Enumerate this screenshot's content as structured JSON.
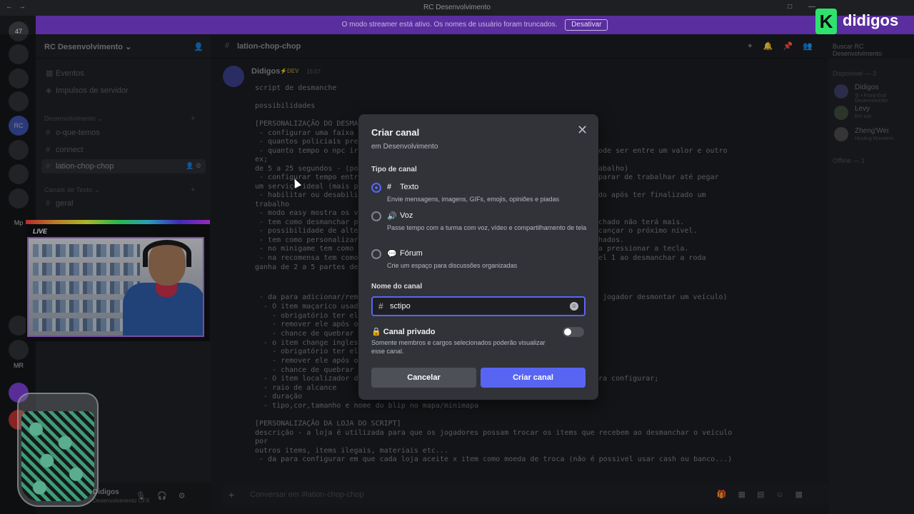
{
  "window": {
    "title": "RC Desenvolvimento"
  },
  "banner": {
    "text": "O modo streamer está ativo. Os nomes de usuário foram truncados.",
    "dismiss_label": "Desativar"
  },
  "servers": [
    {
      "label": "47"
    },
    {
      "label": ""
    },
    {
      "label": ""
    },
    {
      "label": ""
    },
    {
      "label": "RC"
    },
    {
      "label": ""
    },
    {
      "label": ""
    },
    {
      "label": ""
    },
    {
      "label": "Mp"
    },
    {
      "label": ""
    },
    {
      "label": ""
    },
    {
      "label": "MR"
    },
    {
      "label": ""
    },
    {
      "label": ""
    }
  ],
  "sidebar": {
    "guild_name": "RC Desenvolvimento",
    "top_items": [
      {
        "label": "Eventos"
      },
      {
        "label": "Impulsos de servidor"
      }
    ],
    "categories": [
      {
        "label": "Desenvolvimento"
      },
      {
        "label": "Canais de Texto"
      }
    ],
    "channels": [
      {
        "label": "o-que-temos"
      },
      {
        "label": "connect"
      },
      {
        "label": "lation-chop-chop"
      },
      {
        "label": "geral"
      }
    ],
    "user": {
      "name": "Didigos",
      "status": "Desenvolvimento CFX"
    }
  },
  "webcam": {
    "live_label": "LIVE"
  },
  "chat": {
    "channel_name": "lation-chop-chop",
    "search_placeholder": "Buscar RC Desenvolvimento",
    "composer_placeholder": "Conversar em #lation-chop-chop",
    "message": {
      "author": "Didigos",
      "badge": "⚡DEV",
      "time": "15:07",
      "lines": [
        "script de desmanche",
        "possibilidades",
        "[PERSONALIZAÇÃO DO DESMANCHE]",
        " - configurar uma faixa de",
        " - quantos policiais preci",
        " - quanto tempo o npc irá",
        "ex;",
        "de 5 a 25 segundos - (pod",
        " - configurar tempo entre",
        "um serviço ideal (mais pe",
        " - habilitar ou desabilita",
        "trabalho",
        " - modo easy mostra os ve",
        " - tem como desmanchar pe",
        " - possibilidade de alter",
        " - tem como personalizar",
        " - no minigame tem como c",
        " - na recomensa tem como",
        "ganha de 2 a 5 partes de",
        " - da para adicionar/remov",
        "  - O item maçarico usado",
        "    - obrigatório ter ele",
        "    - remover ele após o u",
        "    - chance de quebrar",
        "  - o item change inglesa",
        "    - obrigatório ter ele",
        "    - remover ele após o u",
        "    - chance de quebrar",
        "  - O item localizador de",
        "  - raio de alcance",
        "  - duração",
        "  - tipo,cor,tamanho e nome do blip no mapa/minimapa",
        "[PERSONALIZAÇÃO DA LOJA DO SCRIPT]",
        "descrição - a loja é utilizada para que os jogadores possam trocar os items que recebem ao desmanchar o veículo",
        "por",
        "outros items, items ilegais, materiais etc...",
        " - da para configurar em que cada loja aceite x item como moeda de troca (não é possivel usar cash ou banco...)"
      ],
      "right_fragments": [
        "ode ser entre um valor e outro",
        "abalho)",
        "parar de trabalhar até pegar",
        "do após ter finalizado um",
        "chado não terá mais.",
        "cançar o próximo nível.",
        "hados.",
        "a pressionar a tecla.",
        "el 1 ao desmanchar a roda",
        "jogador desmontar um veículo)",
        "ra configurar;"
      ]
    }
  },
  "members": {
    "online_header": "Disponível — 3",
    "offline_header": "Offline — 1",
    "list": [
      {
        "name": "Didigos",
        "sub": "⚙ • Front-End Desenvolvedor"
      },
      {
        "name": "Levy",
        "sub": "Em voz"
      },
      {
        "name": "Zheng'Wei",
        "sub": "Hosting Monsters"
      }
    ]
  },
  "logo": {
    "mark": "K",
    "word": "didigos"
  },
  "modal": {
    "title": "Criar canal",
    "subtitle": "em Desenvolvimento",
    "type_section": "Tipo de canal",
    "options": [
      {
        "icon": "#",
        "label": "Texto",
        "desc": "Envie mensagens, imagens, GIFs, emojis, opiniões e piadas",
        "selected": true
      },
      {
        "icon": "🔊",
        "label": "Voz",
        "desc": "Passe tempo com a turma com voz, vídeo e compartilhamento de tela",
        "selected": false
      },
      {
        "icon": "💬",
        "label": "Fórum",
        "desc": "Crie um espaço para discussões organizadas",
        "selected": false
      }
    ],
    "name_section": "Nome do canal",
    "name_value": "sctipo",
    "private_label": "Canal privado",
    "private_desc": "Somente membros e cargos selecionados poderão visualizar esse canal.",
    "private_enabled": false,
    "cancel_label": "Cancelar",
    "create_label": "Criar canal",
    "accent_color": "#5865f2"
  }
}
